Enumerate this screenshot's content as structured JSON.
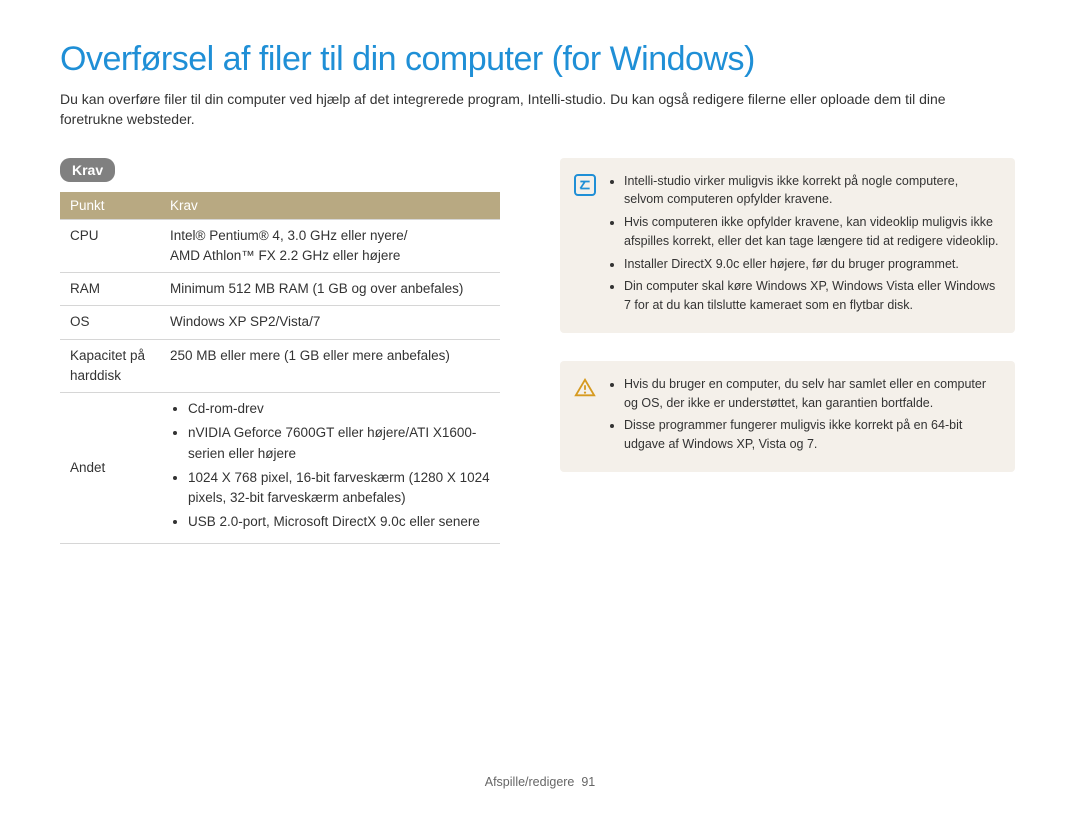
{
  "title": "Overførsel af filer til din computer (for Windows)",
  "intro": "Du kan overføre filer til din computer ved hjælp af det integrerede program, Intelli-studio. Du kan også redigere filerne eller oploade dem til dine foretrukne websteder.",
  "badge": "Krav",
  "table": {
    "headers": {
      "col1": "Punkt",
      "col2": "Krav"
    },
    "rows": {
      "cpu": {
        "label": "CPU",
        "value": "Intel® Pentium® 4, 3.0 GHz eller nyere/\nAMD Athlon™ FX 2.2 GHz eller højere"
      },
      "ram": {
        "label": "RAM",
        "value": "Minimum 512 MB RAM (1 GB og over anbefales)"
      },
      "os": {
        "label": "OS",
        "value": "Windows XP SP2/Vista/7"
      },
      "hdd": {
        "label": "Kapacitet på harddisk",
        "value": "250 MB eller mere (1 GB eller mere anbefales)"
      },
      "other": {
        "label": "Andet",
        "items": [
          "Cd-rom-drev",
          "nVIDIA Geforce 7600GT eller højere/ATI X1600-serien eller højere",
          "1024 X 768 pixel, 16-bit farveskærm (1280 X 1024 pixels, 32-bit farveskærm anbefales)",
          "USB 2.0-port, Microsoft DirectX 9.0c eller senere"
        ]
      }
    }
  },
  "info_box": {
    "items": [
      "Intelli-studio virker muligvis ikke korrekt på nogle computere, selvom computeren opfylder kravene.",
      "Hvis computeren ikke opfylder kravene, kan videoklip muligvis ikke afspilles korrekt, eller det kan tage længere tid at redigere videoklip.",
      "Installer DirectX 9.0c eller højere, før du bruger programmet.",
      "Din computer skal køre Windows XP, Windows Vista eller Windows 7 for at du kan tilslutte kameraet som en flytbar disk."
    ]
  },
  "warn_box": {
    "items": [
      "Hvis du bruger en computer, du selv har samlet eller en computer og OS, der ikke er understøttet, kan garantien bortfalde.",
      "Disse programmer fungerer muligvis ikke korrekt på en 64-bit udgave af Windows XP, Vista og 7."
    ]
  },
  "footer": {
    "section": "Afspille/redigere",
    "page": "91"
  }
}
